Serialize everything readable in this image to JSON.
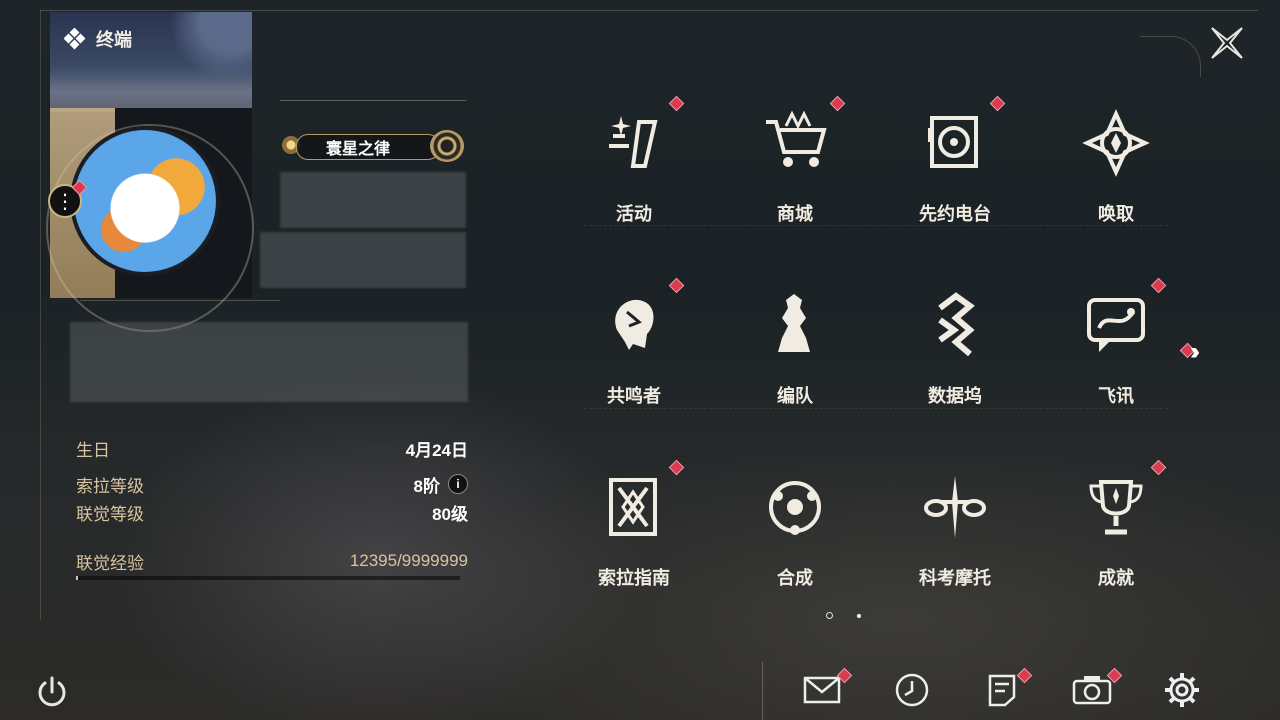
{
  "header": {
    "title": "终端",
    "title_icon": "diamond-cluster-icon",
    "close_icon": "close-x-icon"
  },
  "profile": {
    "avatar_menu_icon": "more-vertical-icon",
    "title_badge": "寰星之律",
    "stats": [
      {
        "label": "生日",
        "value": "4月24日"
      },
      {
        "label": "索拉等级",
        "value": "8阶",
        "info_icon": "info-icon",
        "info_glyph": "i"
      },
      {
        "label": "联觉等级",
        "value": "80级"
      },
      {
        "label": "联觉经验",
        "value": "12395/9999999"
      }
    ],
    "exp_progress": 0.0012
  },
  "menu": {
    "items": [
      {
        "label": "活动",
        "icon": "activity-icon",
        "badge": true
      },
      {
        "label": "商城",
        "icon": "shop-cart-icon",
        "badge": true
      },
      {
        "label": "先约电台",
        "icon": "radio-icon",
        "badge": true
      },
      {
        "label": "唤取",
        "icon": "summon-compass-icon",
        "badge": false
      },
      {
        "label": "共鸣者",
        "icon": "resonator-head-icon",
        "badge": true
      },
      {
        "label": "编队",
        "icon": "chess-team-icon",
        "badge": false
      },
      {
        "label": "数据坞",
        "icon": "data-dock-icon",
        "badge": false
      },
      {
        "label": "飞讯",
        "icon": "message-bubble-icon",
        "badge": true
      },
      {
        "label": "索拉指南",
        "icon": "guide-book-icon",
        "badge": true
      },
      {
        "label": "合成",
        "icon": "synthesis-icon",
        "badge": false
      },
      {
        "label": "科考摩托",
        "icon": "motorbike-icon",
        "badge": false
      },
      {
        "label": "成就",
        "icon": "trophy-icon",
        "badge": true
      }
    ],
    "next_page_icon": "double-chevron-right-icon",
    "pagination": {
      "current": 1,
      "total": 2
    }
  },
  "bottom_bar": {
    "power_icon": "power-icon",
    "items": [
      {
        "name": "mail",
        "icon": "mail-icon",
        "badge": true
      },
      {
        "name": "clock",
        "icon": "clock-icon",
        "badge": false
      },
      {
        "name": "notice",
        "icon": "notice-icon",
        "badge": true
      },
      {
        "name": "camera",
        "icon": "camera-icon",
        "badge": true
      },
      {
        "name": "settings",
        "icon": "gear-icon",
        "badge": false
      }
    ]
  },
  "colors": {
    "badge": "#d93c50",
    "gold": "#c8b58a",
    "text": "#f1ece2",
    "label": "#d9c4a0"
  }
}
